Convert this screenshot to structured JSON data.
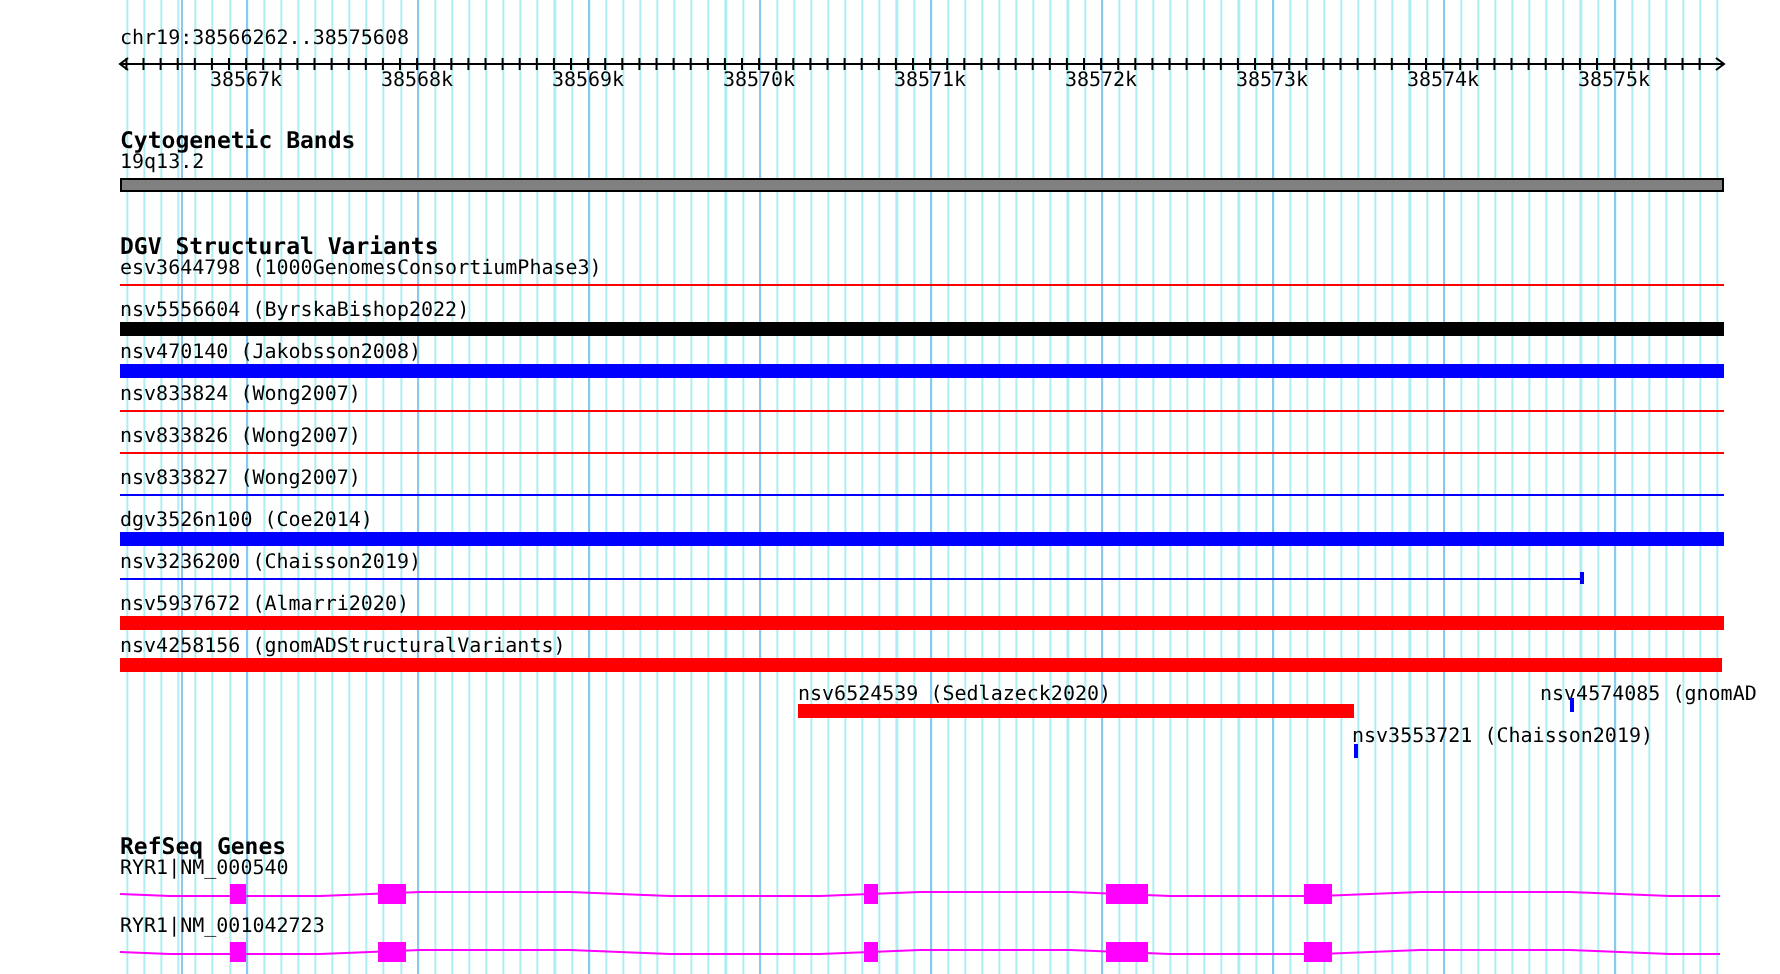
{
  "location": "chr19:38566262..38575608",
  "ruler": {
    "ticks": [
      "38567k",
      "38568k",
      "38569k",
      "38570k",
      "38571k",
      "38572k",
      "38573k",
      "38574k",
      "38575k"
    ]
  },
  "cytoband_track": {
    "title": "Cytogenetic Bands",
    "band": "19q13.2"
  },
  "dgv_track": {
    "title": "DGV Structural Variants",
    "variants": [
      {
        "label": "esv3644798 (1000GenomesConsortiumPhase3)",
        "kind": "thin",
        "color": "#ff0000"
      },
      {
        "label": "nsv5556604 (ByrskaBishop2022)",
        "kind": "thick",
        "color": "#000000"
      },
      {
        "label": "nsv470140 (Jakobsson2008)",
        "kind": "thick",
        "color": "#0000ff"
      },
      {
        "label": "nsv833824 (Wong2007)",
        "kind": "thin",
        "color": "#ff0000"
      },
      {
        "label": "nsv833826 (Wong2007)",
        "kind": "thin",
        "color": "#ff0000"
      },
      {
        "label": "nsv833827 (Wong2007)",
        "kind": "thin",
        "color": "#0000ff"
      },
      {
        "label": "dgv3526n100 (Coe2014)",
        "kind": "thick",
        "color": "#0000ff"
      },
      {
        "label": "nsv3236200 (Chaisson2019)",
        "kind": "thin",
        "color": "#0000ff"
      },
      {
        "label": "nsv5937672 (Almarri2020)",
        "kind": "thick",
        "color": "#ff0000"
      },
      {
        "label": "nsv4258156 (gnomADStructuralVariants)",
        "kind": "thick",
        "color": "#ff0000"
      },
      {
        "label": "nsv6524539 (Sedlazeck2020)",
        "kind": "thick",
        "color": "#ff0000"
      },
      {
        "label": "nsv4574085 (gnomAD",
        "kind": "tick",
        "color": "#0000ff"
      },
      {
        "label": "nsv3553721 (Chaisson2019)",
        "kind": "tick",
        "color": "#0000ff"
      }
    ]
  },
  "refseq_track": {
    "title": "RefSeq Genes",
    "transcripts": [
      {
        "label": "RYR1|NM_000540"
      },
      {
        "label": "RYR1|NM_001042723"
      }
    ]
  }
}
